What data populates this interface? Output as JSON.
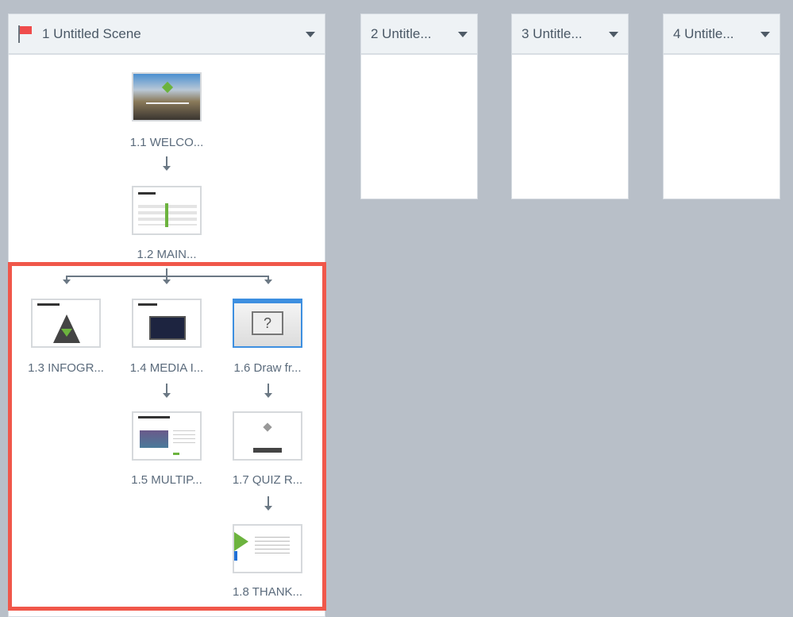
{
  "scenes": [
    {
      "title": "1 Untitled Scene"
    },
    {
      "title": "2 Untitle..."
    },
    {
      "title": "3 Untitle..."
    },
    {
      "title": "4 Untitle..."
    }
  ],
  "slides": [
    {
      "label": "1.1  WELCO..."
    },
    {
      "label": "1.2  MAIN..."
    },
    {
      "label": "1.3  INFOGR..."
    },
    {
      "label": "1.4 MEDIA I..."
    },
    {
      "label": "1.5  MULTIP..."
    },
    {
      "label": "1.6 Draw fr..."
    },
    {
      "label": "1.7 QUIZ R..."
    },
    {
      "label": "1.8  THANK..."
    }
  ],
  "colors": {
    "highlight": "#f0574a",
    "accent": "#6cb33e",
    "selected": "#3d8fe0"
  }
}
